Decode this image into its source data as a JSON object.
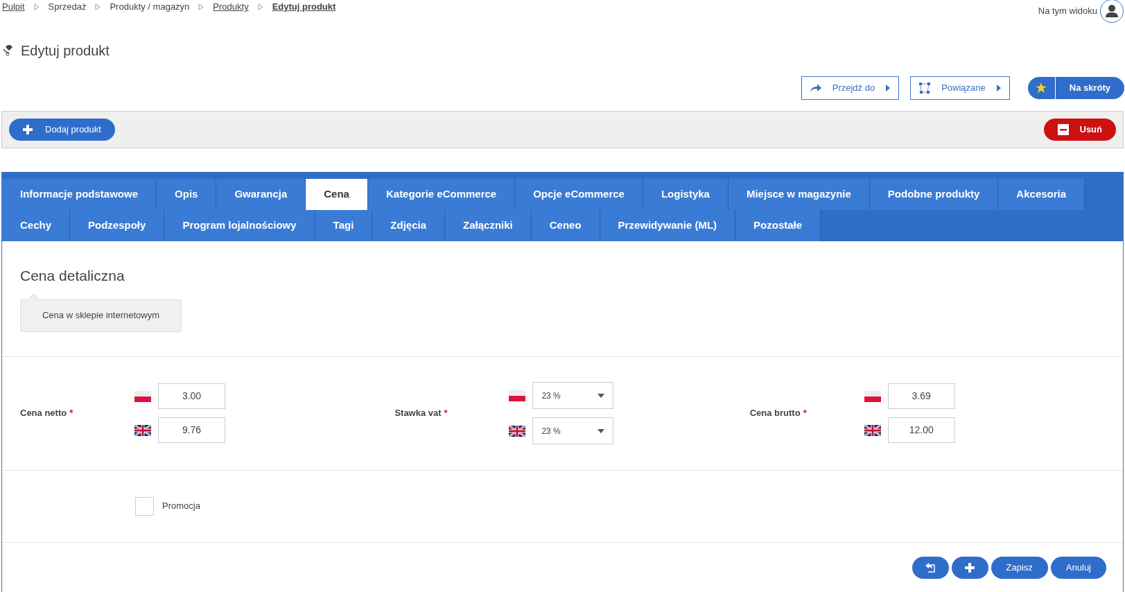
{
  "breadcrumb": [
    {
      "label": "Pulpit",
      "link": true,
      "current": false
    },
    {
      "label": "Sprzedaż",
      "link": false,
      "current": false
    },
    {
      "label": "Produkty / magazyn",
      "link": false,
      "current": false
    },
    {
      "label": "Produkty",
      "link": true,
      "current": false
    },
    {
      "label": "Edytuj produkt",
      "link": true,
      "current": true
    }
  ],
  "user": {
    "label": "Na tym widoku"
  },
  "page_title": "Edytuj produkt",
  "header_buttons": [
    {
      "label": "Przejdź do",
      "kind": "arrow"
    },
    {
      "label": "Powiązane",
      "kind": "nodes"
    }
  ],
  "shortcut_button": {
    "label": "Na skróty"
  },
  "toolbar": {
    "add": "Dodaj produkt",
    "delete": "Usuń"
  },
  "tabs": [
    [
      {
        "label": "Informacje podstawowe",
        "selected": false
      },
      {
        "label": "Opis",
        "selected": false
      },
      {
        "label": "Gwarancja",
        "selected": false
      },
      {
        "label": "Cena",
        "selected": true
      },
      {
        "label": "Kategorie eCommerce",
        "selected": false
      },
      {
        "label": "Opcje eCommerce",
        "selected": false
      },
      {
        "label": "Logistyka",
        "selected": false
      },
      {
        "label": "Miejsce w magazynie",
        "selected": false
      },
      {
        "label": "Podobne produkty",
        "selected": false
      },
      {
        "label": "Akcesoria",
        "selected": false
      }
    ],
    [
      {
        "label": "Cechy",
        "selected": false
      },
      {
        "label": "Podzespoły",
        "selected": false
      },
      {
        "label": "Program lojalnościowy",
        "selected": false
      },
      {
        "label": "Tagi",
        "selected": false
      },
      {
        "label": "Zdjęcia",
        "selected": false
      },
      {
        "label": "Załączniki",
        "selected": false
      },
      {
        "label": "Ceneo",
        "selected": false
      },
      {
        "label": "Przewidywanie (ML)",
        "selected": false
      },
      {
        "label": "Pozostałe",
        "selected": false
      }
    ]
  ],
  "section": {
    "title": "Cena detaliczna",
    "hint": "Cena w sklepie internetowym"
  },
  "fields": [
    {
      "label": "Cena netto",
      "required_mark": "*",
      "kind": "input",
      "values": [
        {
          "kind": "pl",
          "value": "3.00"
        },
        {
          "kind": "gb",
          "value": "9.76"
        }
      ]
    },
    {
      "label": "Stawka vat",
      "required_mark": "*",
      "kind": "select",
      "values": [
        {
          "kind": "pl",
          "value": "23 %"
        },
        {
          "kind": "gb",
          "value": "23 %"
        }
      ]
    },
    {
      "label": "Cena brutto",
      "required_mark": "*",
      "kind": "input",
      "values": [
        {
          "kind": "pl",
          "value": "3.69"
        },
        {
          "kind": "gb",
          "value": "12.00"
        }
      ]
    }
  ],
  "promotion": {
    "label": "Promocja",
    "checked": false
  },
  "footer_buttons": [
    {
      "kind": "icon-back"
    },
    {
      "kind": "icon-plus"
    },
    {
      "kind": "text",
      "label": "Zapisz"
    },
    {
      "kind": "text",
      "label": "Anuluj"
    }
  ]
}
